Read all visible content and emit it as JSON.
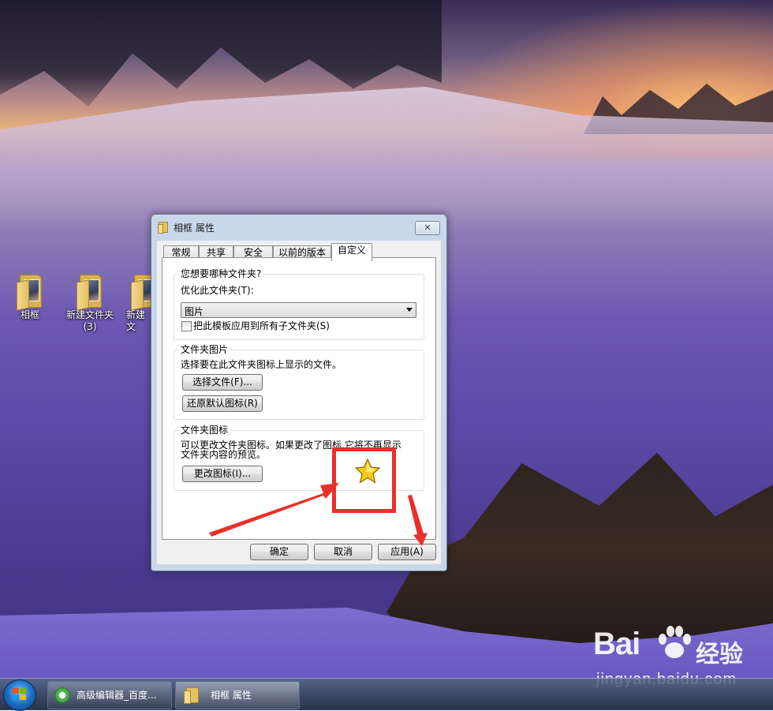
{
  "desktop": {
    "icons": [
      {
        "label": "相框"
      },
      {
        "label": "新建文件夹\n(3)"
      },
      {
        "label": "新建文"
      }
    ]
  },
  "dialog": {
    "title": "相框 属性",
    "close_glyph": "✕",
    "tabs": [
      "常规",
      "共享",
      "安全",
      "以前的版本",
      "自定义"
    ],
    "active_tab": "自定义",
    "group1": {
      "title": "您想要哪种文件夹?",
      "optimize_label": "优化此文件夹(T):",
      "combo_value": "图片",
      "apply_sub_label": "把此模板应用到所有子文件夹(S)",
      "apply_sub_checked": false
    },
    "group2": {
      "title": "文件夹图片",
      "desc": "选择要在此文件夹图标上显示的文件。",
      "choose_file": "选择文件(F)...",
      "restore_default": "还原默认图标(R)"
    },
    "group3": {
      "title": "文件夹图标",
      "desc_line1": "可以更改文件夹图标。如果更改了图标,它将不再显示",
      "desc_line2": "文件夹内容的预览。",
      "change_icon": "更改图标(I)...",
      "icon_preview": "star-icon"
    },
    "footer": {
      "ok": "确定",
      "cancel": "取消",
      "apply": "应用(A)"
    }
  },
  "taskbar": {
    "items": [
      {
        "label": "高级编辑器_百度..."
      },
      {
        "label": "相框 属性"
      }
    ]
  },
  "watermark": {
    "brand": "Bai",
    "brand_cn": "经验",
    "url": "jingyan.baidu.com"
  },
  "colors": {
    "annotation_red": "#e8302a",
    "dialog_frame": "#c8d8ea",
    "star_gold": "#f5c918"
  }
}
